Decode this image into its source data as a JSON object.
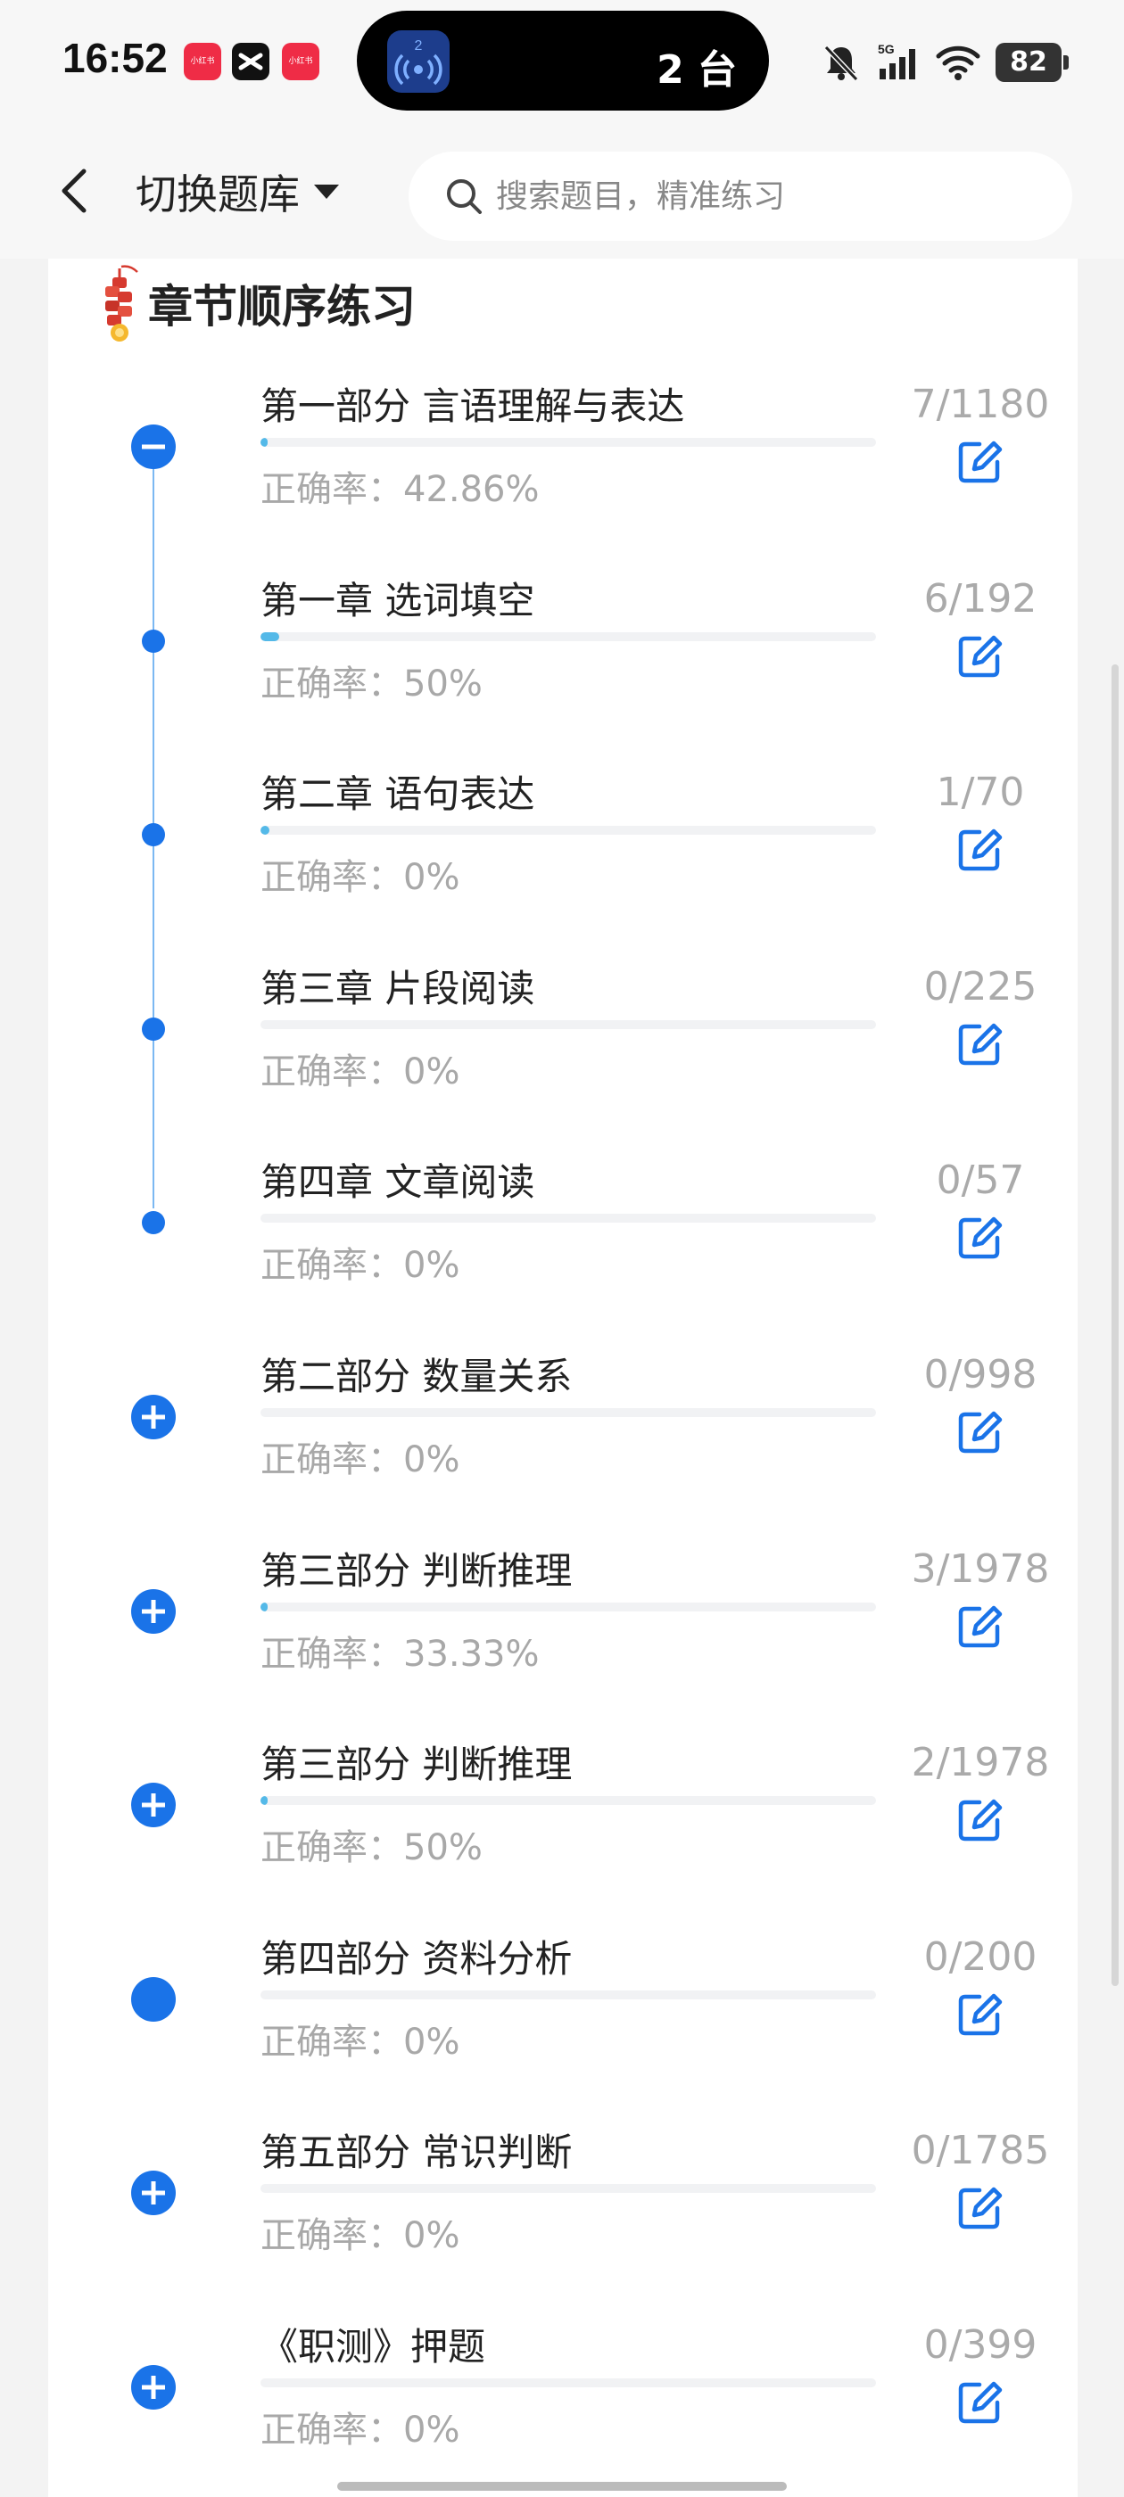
{
  "status_bar": {
    "time": "16:52",
    "apps": [
      {
        "name": "xiaohongshu-icon",
        "label": "小红书",
        "color": "#ef2c46"
      },
      {
        "name": "capcut-icon",
        "label": "",
        "color": "#111111"
      },
      {
        "name": "xiaohongshu-icon",
        "label": "小红书",
        "color": "#ef2c46"
      }
    ],
    "island_badge": "2",
    "island_text": "2 台",
    "signal_label": "5G",
    "battery": "82"
  },
  "header": {
    "switch_bank_label": "切换题库",
    "search_placeholder": "搜索题目，精准练习"
  },
  "section": {
    "title": "章节顺序练习"
  },
  "accent_color": "#1a73e8",
  "progress_color": "#54b9e8",
  "chapters": [
    {
      "title": "第一部分 言语理解与表达",
      "accuracy": "正确率：42.86%",
      "count": "7/1180",
      "progress": 0.006,
      "node": "minus"
    },
    {
      "title": "第一章 选词填空",
      "accuracy": "正确率：50%",
      "count": "6/192",
      "progress": 0.031,
      "node": "dot"
    },
    {
      "title": "第二章 语句表达",
      "accuracy": "正确率：0%",
      "count": "1/70",
      "progress": 0.014,
      "node": "dot"
    },
    {
      "title": "第三章 片段阅读",
      "accuracy": "正确率：0%",
      "count": "0/225",
      "progress": 0,
      "node": "dot"
    },
    {
      "title": "第四章 文章阅读",
      "accuracy": "正确率：0%",
      "count": "0/57",
      "progress": 0,
      "node": "dot"
    },
    {
      "title": "第二部分 数量关系",
      "accuracy": "正确率：0%",
      "count": "0/998",
      "progress": 0,
      "node": "plus"
    },
    {
      "title": "第三部分 判断推理",
      "accuracy": "正确率：33.33%",
      "count": "3/1978",
      "progress": 0.0015,
      "node": "plus"
    },
    {
      "title": "第三部分 判断推理",
      "accuracy": "正确率：50%",
      "count": "2/1978",
      "progress": 0.001,
      "node": "plus"
    },
    {
      "title": "第四部分 资料分析",
      "accuracy": "正确率：0%",
      "count": "0/200",
      "progress": 0,
      "node": "filled"
    },
    {
      "title": "第五部分 常识判断",
      "accuracy": "正确率：0%",
      "count": "0/1785",
      "progress": 0,
      "node": "plus"
    },
    {
      "title": "《职测》押题",
      "accuracy": "正确率：0%",
      "count": "0/399",
      "progress": 0,
      "node": "plus"
    }
  ]
}
